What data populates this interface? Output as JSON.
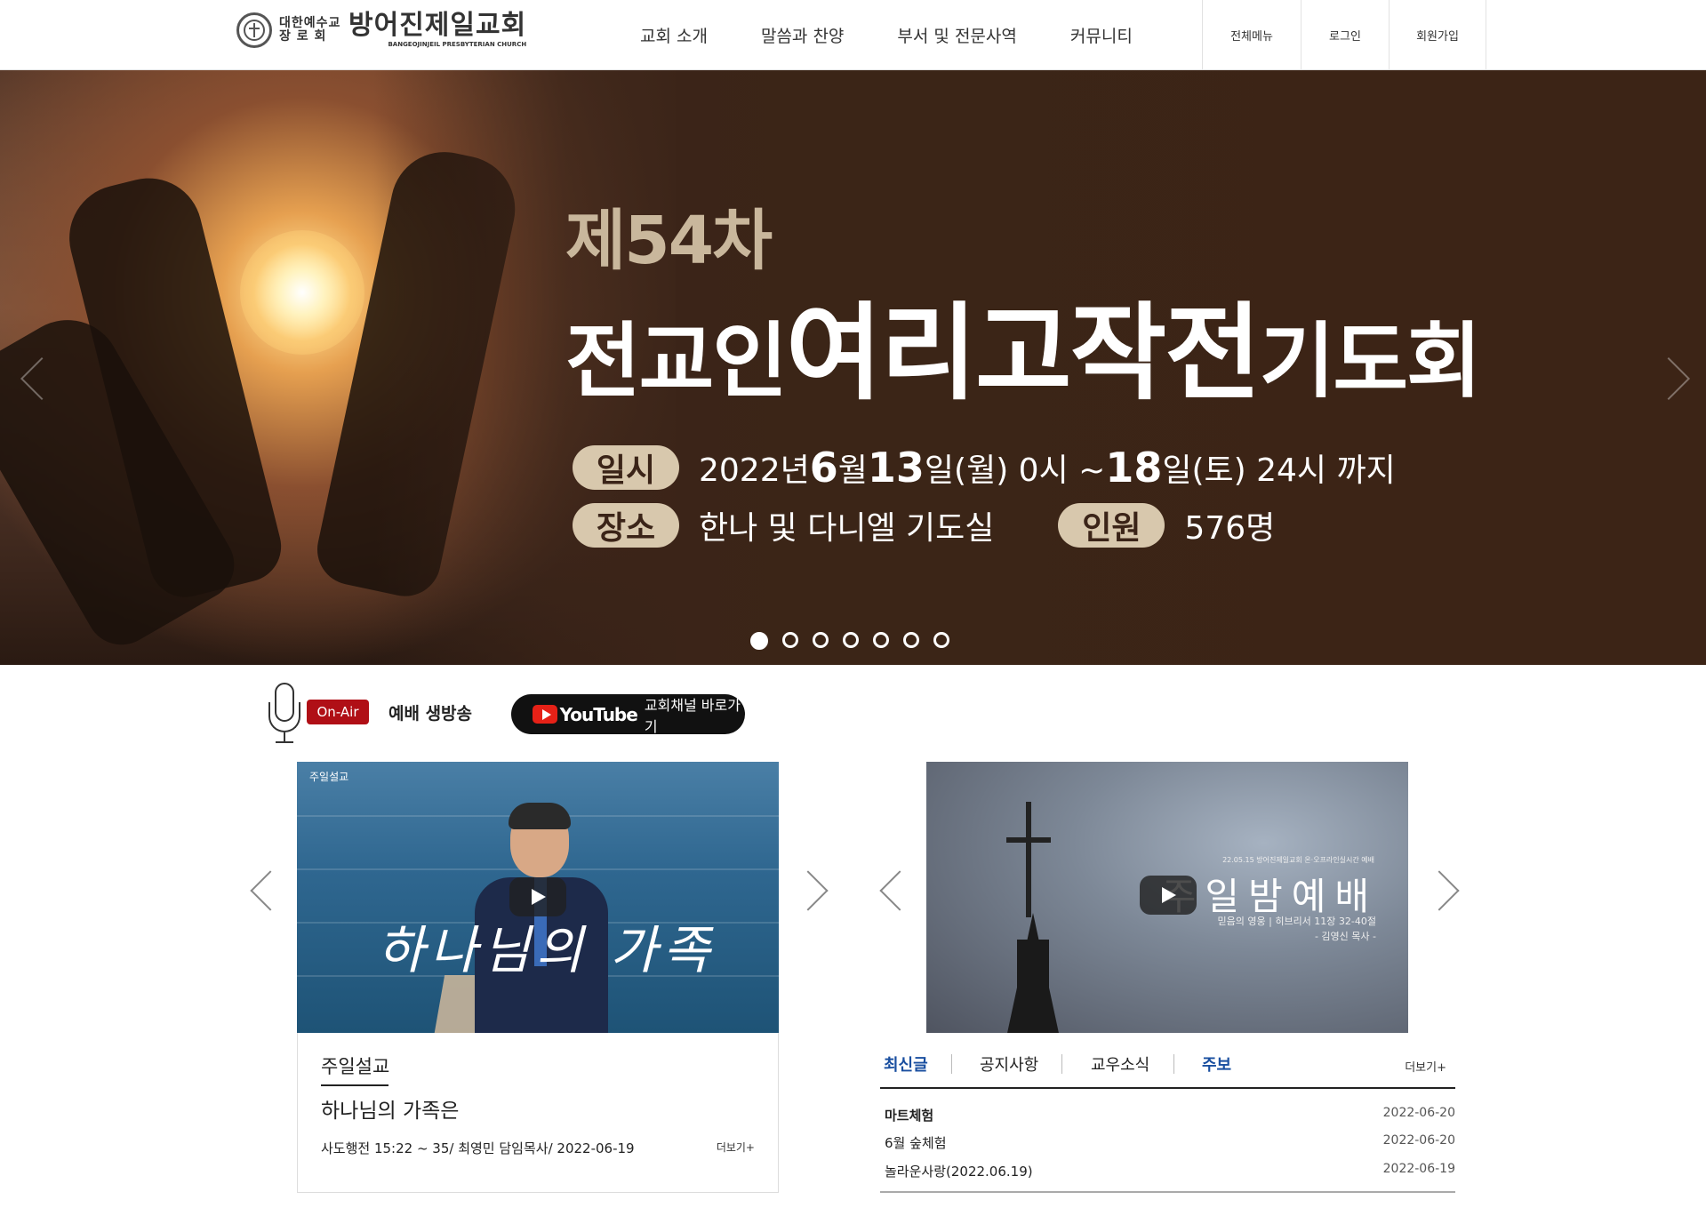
{
  "header": {
    "logo": {
      "denomination": "대한예수교 장 로 회",
      "name": "방어진제일교회",
      "english": "BANGEOJINJEIL PRESBYTERIAN CHURCH"
    },
    "nav": [
      "교회 소개",
      "말씀과 찬양",
      "부서 및 전문사역",
      "커뮤니티"
    ],
    "util": [
      "전체메뉴",
      "로그인",
      "회원가입"
    ]
  },
  "hero": {
    "subtitle": "제54차",
    "title_part1": "전교인",
    "title_part2": "여리고작전",
    "title_part3": "기도회",
    "when_label": "일시",
    "when_text_a": "2022년 ",
    "when_big1": "6",
    "when_text_b": "월 ",
    "when_big2": "13",
    "when_text_c": "일(월) 0시 ~ ",
    "when_big3": "18",
    "when_text_d": "일(토) 24시 까지",
    "place_label": "장소",
    "place_text": "한나 및 다니엘 기도실",
    "count_label": "인원",
    "count_text": "576명",
    "slides": 7,
    "active_slide": 1
  },
  "live": {
    "onair": "On-Air",
    "label": "예배 생방송",
    "youtube_brand": "YouTube",
    "youtube_text": "교회채널 바로가기"
  },
  "video1": {
    "thumb_label": "주일설교",
    "thumb_script": "하나님의 가족"
  },
  "video2": {
    "small_top": "22.05.15 방어진제일교회 온·오프라인실시간 예배",
    "big": "주일밤예배",
    "small_line1": "믿음의 영웅 | 히브리서 11장 32-40절",
    "small_line2": "- 김영신 목사 -"
  },
  "sermon": {
    "category": "주일설교",
    "title": "하나님의 가족은",
    "meta": "사도행전 15:22 ~ 35/  최영민 담임목사/  2022-06-19",
    "more": "더보기+"
  },
  "board": {
    "tabs": [
      "최신글",
      "공지사항",
      "교우소식",
      "주보"
    ],
    "active_tab": 0,
    "more": "더보기+",
    "posts": [
      {
        "title": "마트체험",
        "date": "2022-06-20"
      },
      {
        "title": "6월 숲체험",
        "date": "2022-06-20"
      },
      {
        "title": "놀라운사랑(2022.06.19)",
        "date": "2022-06-19"
      }
    ]
  },
  "colors": {
    "hero_bg": "#3b2418",
    "pill": "#d8c8ad",
    "onair": "#b00f16",
    "accent_tab": "#1a4fa0"
  }
}
